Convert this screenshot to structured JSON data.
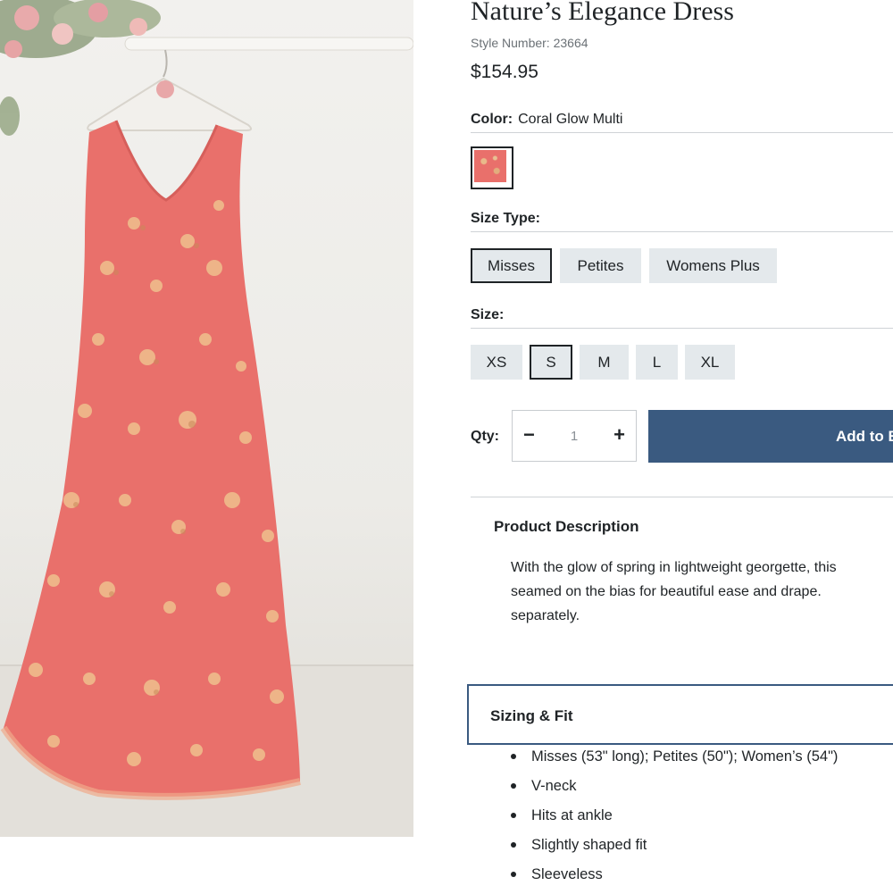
{
  "product": {
    "title": "Nature’s Elegance Dress",
    "style_number": "Style Number: 23664",
    "price": "$154.95",
    "image_alt": "Coral floral maxi dress on hanger"
  },
  "color": {
    "label": "Color:",
    "value": "Coral Glow Multi",
    "swatch_color": "#e9706b"
  },
  "size_type": {
    "label": "Size Type:",
    "options": [
      "Misses",
      "Petites",
      "Womens Plus"
    ],
    "selected": "Misses"
  },
  "size": {
    "label": "Size:",
    "options": [
      "XS",
      "S",
      "M",
      "L",
      "XL"
    ],
    "selected": "S"
  },
  "quantity": {
    "label": "Qty:",
    "minus": "−",
    "value": "1",
    "plus": "+"
  },
  "add_button": {
    "label": "Add to Bag"
  },
  "description": {
    "heading": "Product Description",
    "lines": [
      "With the glow of spring in lightweight georgette, this",
      "seamed on the bias for beautiful ease and drape.",
      "separately."
    ]
  },
  "sizing_fit": {
    "heading": "Sizing & Fit",
    "bullets": [
      "Misses (53\" long); Petites (50\"); Women’s (54\")",
      "V-neck",
      "Hits at ankle",
      "Slightly shaped fit",
      "Sleeveless"
    ]
  },
  "colors": {
    "button_blue": "#3a5a80",
    "chip_grey": "#e4e9ec",
    "dress_coral": "#e9706b"
  }
}
